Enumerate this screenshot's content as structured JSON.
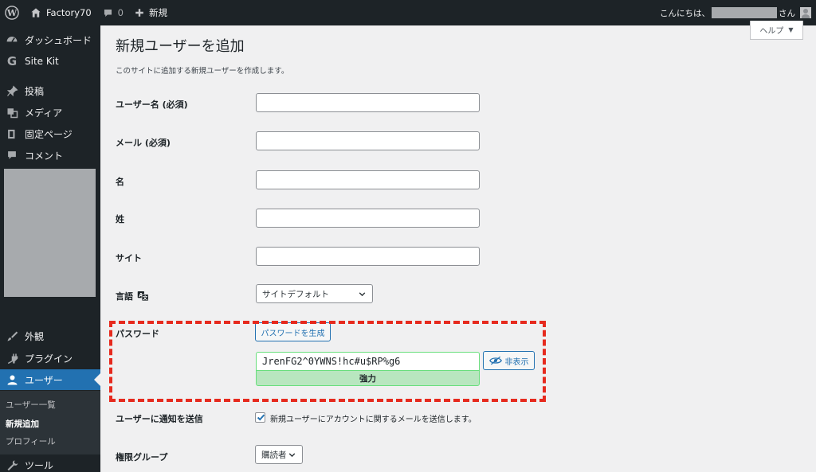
{
  "admin_bar": {
    "site_name": "Factory70",
    "comments_count": "0",
    "new_label": "新規",
    "greeting": "こんにちは、",
    "greeting_suffix": "さん"
  },
  "sidebar": {
    "items": [
      {
        "label": "ダッシュボード",
        "icon": "dashboard-icon"
      },
      {
        "label": "Site Kit",
        "icon": "google-g-icon"
      },
      {
        "label": "投稿",
        "icon": "pin-icon"
      },
      {
        "label": "メディア",
        "icon": "media-icon"
      },
      {
        "label": "固定ページ",
        "icon": "page-icon"
      },
      {
        "label": "コメント",
        "icon": "comment-icon"
      },
      {
        "label": "外観",
        "icon": "brush-icon"
      },
      {
        "label": "プラグイン",
        "icon": "plugin-icon"
      },
      {
        "label": "ユーザー",
        "icon": "user-icon"
      },
      {
        "label": "ツール",
        "icon": "wrench-icon"
      }
    ],
    "submenu": [
      "ユーザー一覧",
      "新規追加",
      "プロフィール"
    ]
  },
  "help_tab": "ヘルプ",
  "page": {
    "title": "新規ユーザーを追加",
    "description": "このサイトに追加する新規ユーザーを作成します。"
  },
  "form": {
    "username_label": "ユーザー名 (必須)",
    "email_label": "メール (必須)",
    "first_name_label": "名",
    "last_name_label": "姓",
    "website_label": "サイト",
    "language_label": "言語",
    "language_value": "サイトデフォルト",
    "password_label": "パスワード",
    "generate_password_button": "パスワードを生成",
    "password_value": "JrenFG2^0YWNS!hc#u$RP%g6",
    "password_strength": "強力",
    "hide_button": "非表示",
    "notify_label": "ユーザーに通知を送信",
    "notify_checkbox_label": "新規ユーザーにアカウントに関するメールを送信します。",
    "notify_checked": true,
    "role_label": "権限グループ",
    "role_value": "購読者"
  },
  "colors": {
    "admin_bar": "#1d2327",
    "accent": "#2271b1",
    "highlight_dashes": "#e62a1e",
    "strength_bg": "#b8e6bf"
  }
}
